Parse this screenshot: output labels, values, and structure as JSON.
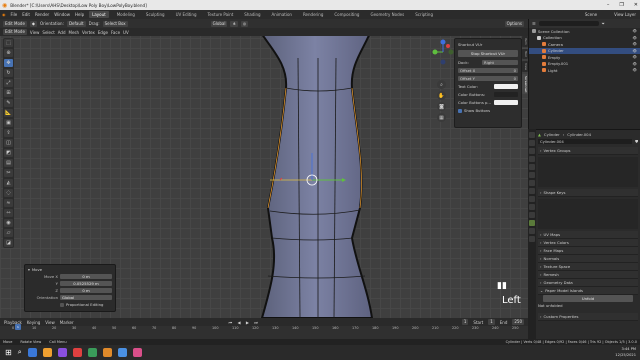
{
  "window": {
    "title": "Blender* [C:\\Users\\AHS\\Desktop\\Low Poly Boy\\LowPolyBoy.blend]",
    "controls": [
      "–",
      "❐",
      "✕"
    ]
  },
  "menubar": {
    "items": [
      "File",
      "Edit",
      "Render",
      "Window",
      "Help"
    ],
    "workspaces": [
      "Layout",
      "Modeling",
      "Sculpting",
      "UV Editing",
      "Texture Paint",
      "Shading",
      "Animation",
      "Rendering",
      "Compositing",
      "Geometry Nodes",
      "Scripting"
    ],
    "active_workspace": "Layout",
    "scene_label": "Scene",
    "view_layer_label": "View Layer"
  },
  "viewport_header": {
    "mode": "Edit Mode",
    "menus": [
      "View",
      "Select",
      "Add",
      "Mesh",
      "Vertex",
      "Edge",
      "Face",
      "UV"
    ],
    "orientation_label": "Orientation:",
    "orientation_value": "Default",
    "drag_label": "Drag:",
    "drag_value": "Select Box",
    "transform_global": "Global",
    "options": "Options"
  },
  "npanel": {
    "heading": "Shortcut VUr",
    "stop_button": "Stop Shortcut VUr",
    "dock_label": "Dock:",
    "dock_value": "Right",
    "offset_x_label": "Offset X",
    "offset_x_value": "0",
    "offset_y_label": "Offset Y",
    "offset_y_value": "0",
    "text_color_label": "Text Color:",
    "color_buttons_label": "Color Buttons:",
    "color_buttons_p_label": "Color Buttons p...",
    "show_buttons_label": "Show Buttons",
    "tabs": [
      "Item",
      "Tool",
      "View",
      "Screencast"
    ]
  },
  "view_label": "Left",
  "operator_panel": {
    "title": "Move",
    "move_x_label": "Move X",
    "move_x_value": "0 m",
    "y_label": "Y",
    "y_value": "0.0525529 m",
    "z_label": "Z",
    "z_value": "0 m",
    "orientation_label": "Orientation",
    "orientation_value": "Global",
    "proportional_label": "Proportional Editing"
  },
  "outliner": {
    "search_placeholder": "",
    "items": [
      {
        "label": "Scene Collection",
        "indent": 0,
        "color": "#999999"
      },
      {
        "label": "Collection",
        "indent": 1,
        "color": "#cccccc"
      },
      {
        "label": "Camera",
        "indent": 2,
        "color": "#e37c3b"
      },
      {
        "label": "Cylinder",
        "indent": 2,
        "color": "#e37c3b",
        "selected": true
      },
      {
        "label": "Empty",
        "indent": 2,
        "color": "#e37c3b"
      },
      {
        "label": "Empty.001",
        "indent": 2,
        "color": "#e37c3b"
      },
      {
        "label": "Light",
        "indent": 2,
        "color": "#e37c3b"
      }
    ]
  },
  "properties": {
    "object_name": "Cylinder",
    "mesh_tab": "Cylinder.004",
    "mesh_field": "Cylinder.004",
    "sections": [
      "Vertex Groups",
      "Shape Keys",
      "UV Maps",
      "Vertex Colors",
      "Face Maps",
      "Normals",
      "Texture Space",
      "Remesh",
      "Geometry Data",
      "Paper Model Islands"
    ],
    "unfold_button": "Unfold",
    "not_unfolded": "Not unfolded",
    "custom_properties": "Custom Properties"
  },
  "timeline": {
    "menus": [
      "Playback",
      "Keying",
      "View",
      "Marker"
    ],
    "current_frame": "1",
    "start_label": "Start",
    "start_value": "1",
    "end_label": "End",
    "end_value": "250",
    "ticks": [
      "0",
      "10",
      "20",
      "30",
      "40",
      "50",
      "60",
      "70",
      "80",
      "90",
      "100",
      "110",
      "120",
      "130",
      "140",
      "150",
      "160",
      "170",
      "180",
      "190",
      "200",
      "210",
      "220",
      "230",
      "240",
      "250"
    ]
  },
  "statusbar": {
    "left_items": [
      "Move",
      "Rotate View",
      "Call Menu"
    ],
    "right_text": "Cylinder | Verts 0/48 | Edges 0/92 | Faces 0/46 | Tris 92 | Objects 1/5 | 3.0.0"
  },
  "taskbar": {
    "time": "3:44 PM",
    "date": "12/25/2021",
    "icon_colors": [
      "#3a78d8",
      "#f0a030",
      "#8a4fe0",
      "#e04040",
      "#3a9c5a",
      "#e08a2a",
      "#4a90e2",
      "#d94f8a"
    ]
  }
}
